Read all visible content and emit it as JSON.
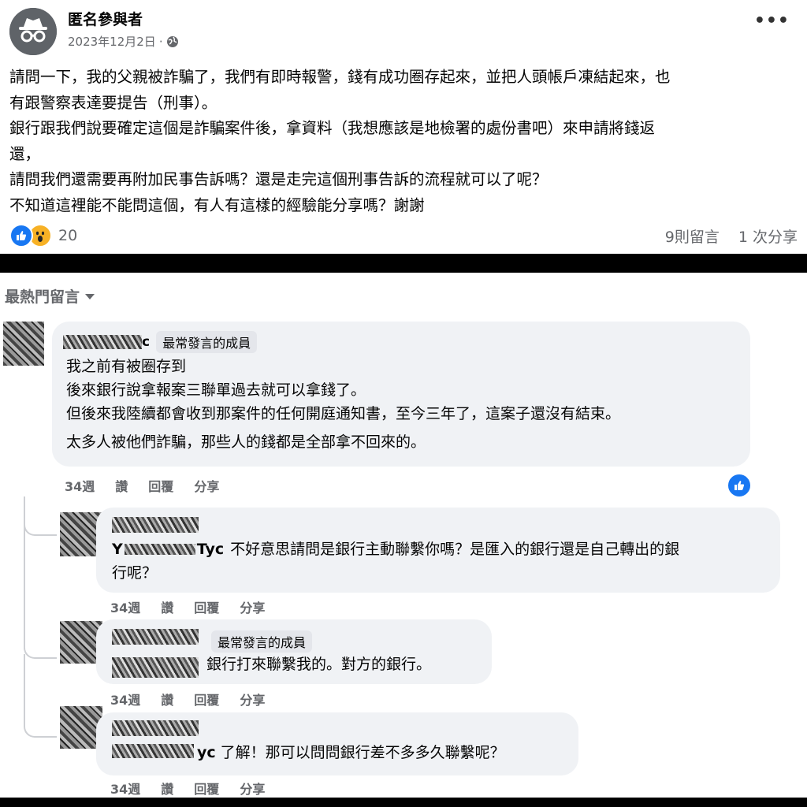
{
  "post": {
    "author": "匿名參與者",
    "date": "2023年12月2日",
    "meta_separator": "·",
    "privacy_icon": "globe-icon",
    "more_label": "•••",
    "lines": [
      "請問一下，我的父親被詐騙了，我們有即時報警，錢有成功圈存起來，並把人頭帳戶凍結起來，也",
      "有跟警察表達要提告（刑事）。",
      "銀行跟我們說要確定這個是詐騙案件後，拿資料（我想應該是地檢署的處份書吧）來申請將錢返",
      "還，",
      "請問我們還需要再附加民事告訴嗎？還是走完這個刑事告訴的流程就可以了呢？",
      "不知道這裡能不能問這個，有人有這樣的經驗能分享嗎？謝謝"
    ],
    "reaction_count": "20",
    "comments_count": "9則留言",
    "shares_count": "1 次分享"
  },
  "comments_header": {
    "sort_label": "最熱門留言",
    "dropdown_icon": "caret-down-icon"
  },
  "comments": [
    {
      "name_suffix": "c",
      "badge": "最常發言的成員",
      "lines": [
        "我之前有被圈存到",
        "後來銀行說拿報案三聯單過去就可以拿錢了。",
        "但後來我陸續都會收到那案件的任何開庭通知書，至今三年了，這案子還沒有結束。",
        "太多人被他們詐騙，那些人的錢都是全部拿不回來的。"
      ],
      "time": "34週",
      "like": "讚",
      "reply": "回覆",
      "share": "分享"
    },
    {
      "mention_fragment": "Y",
      "mention_suffix": "Tyc",
      "lines": [
        "不好意思請問是銀行主動聯繫你嗎？是匯入的銀行還是自己轉出的銀",
        "行呢？"
      ],
      "time": "34週",
      "like": "讚",
      "reply": "回覆",
      "share": "分享"
    },
    {
      "badge": "最常發言的成員",
      "lines": [
        "銀行打來聯繫我的。對方的銀行。"
      ],
      "time": "34週",
      "like": "讚",
      "reply": "回覆",
      "share": "分享"
    },
    {
      "mention_suffix": "yc",
      "lines": [
        "了解！那可以問問銀行差不多多久聯繫呢？"
      ],
      "time": "34週",
      "like": "讚",
      "reply": "回覆",
      "share": "分享"
    }
  ],
  "colors": {
    "facebook_blue": "#1877f2",
    "bubble_gray": "#f0f2f5",
    "meta_gray": "#65676b",
    "wow_yellow": "#f7b125"
  }
}
